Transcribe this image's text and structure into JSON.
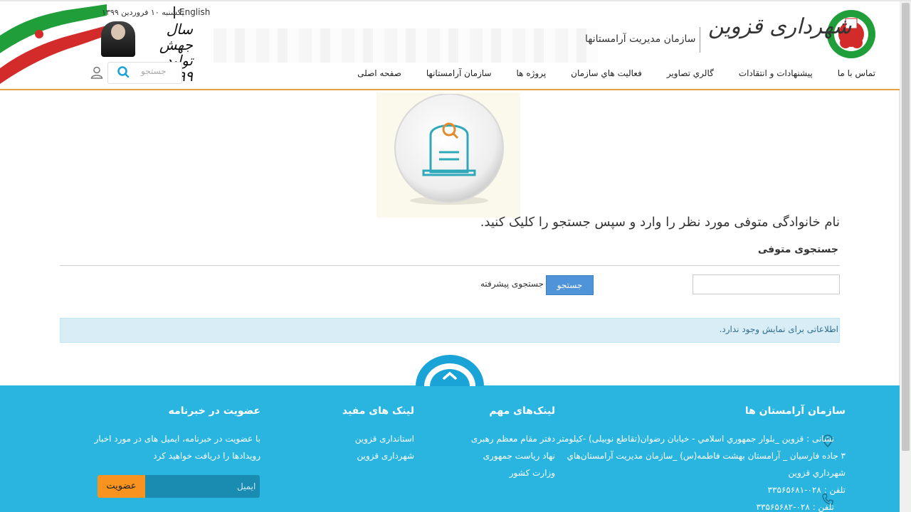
{
  "header": {
    "date": "یکشنبه ۱۰ فروردین ۱۳۹۹",
    "language_link": "English",
    "slogan": "سال جهش تولید ۱۳۹۹",
    "brand": "شهرداری قزوین",
    "org_name": "سازمان مدیریت آرامستانها",
    "search_placeholder": "جستجو"
  },
  "nav": {
    "items": [
      "صفحه اصلی",
      "سازمان آرامستانها",
      "پروژه ها",
      "فعالیت هاي سازمان",
      "گالري تصاوير",
      "پیشنهادات و انتقادات",
      "تماس با ما"
    ]
  },
  "main": {
    "instruction": "نام خانوادگی متوفی مورد نظر را وارد و سپس جستجو را کلیک کنید.",
    "section_title": "جستجوی متوفی",
    "search_button": "جستجو",
    "advanced_link": "جستجوی پیشرفته",
    "info_message": "اطلاعاتی برای نمایش وجود ندارد."
  },
  "footer": {
    "col_org": {
      "title": "سازمان آرامستان ها",
      "address_lines": [
        "نشانی : قزوين _بلوار جمهوري اسلامي - خيابان رضوان(تقاطع نوبيلی) -كيلومتر",
        "۳ جاده فارسیان _ آرامستان بهشت فاطمه(س) _سازمان مديريت آرامستان‌هاي",
        "شهرداري قزوين"
      ],
      "phone1": "تلفن : ۰۲۸-۳۳۵۶۵۶۸۱",
      "phone2": "تلفن : ۰۲۸-۳۳۵۶۵۶۸۲"
    },
    "col_important": {
      "title": "لینک‌های مهم",
      "links": [
        "دفتر مقام معظم رهبری",
        "نهاد ریاست جمهوری",
        "وزارت کشور"
      ]
    },
    "col_useful": {
      "title": "لینک های مفید",
      "links": [
        "استانداری قزوین",
        "شهرداری قزوین"
      ]
    },
    "col_newsletter": {
      "title": "عضویت در خبرنامه",
      "desc_lines": [
        "با عضویت در خبرنامه، ایمیل های در مورد اخبار",
        "رویدادها را دریافت خواهید کرد"
      ],
      "email_placeholder": "ایمیل",
      "subscribe_button": "عضویت"
    }
  },
  "colors": {
    "accent_orange": "#e8a33c",
    "footer_blue": "#29b5e0",
    "button_blue": "#4f93d8",
    "subscribe_orange": "#f7931e",
    "info_bg": "#d9edf7"
  }
}
